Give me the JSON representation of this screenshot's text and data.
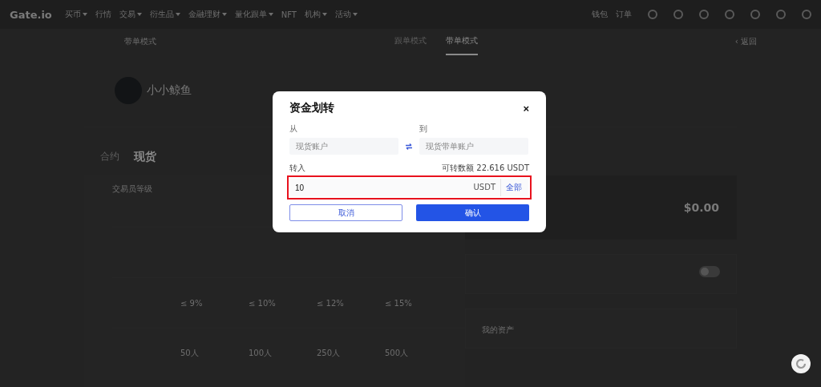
{
  "nav": {
    "logo": "Gate.io",
    "items": [
      {
        "label": "买币",
        "caret": true
      },
      {
        "label": "行情",
        "caret": false
      },
      {
        "label": "交易",
        "caret": true
      },
      {
        "label": "衍生品",
        "caret": true
      },
      {
        "label": "金融理财",
        "caret": true
      },
      {
        "label": "量化跟单",
        "caret": true
      },
      {
        "label": "NFT",
        "caret": false
      },
      {
        "label": "机构",
        "caret": true
      },
      {
        "label": "活动",
        "caret": true
      }
    ],
    "right_items": [
      {
        "label": "钱包"
      },
      {
        "label": "订单"
      }
    ]
  },
  "subbar": {
    "title": "带单模式",
    "tabs": [
      {
        "label": "跟单模式",
        "selected": false
      },
      {
        "label": "带单模式",
        "selected": true
      }
    ],
    "back_icon": "‹",
    "back": "返回"
  },
  "profile": {
    "name": "小小鲸鱼"
  },
  "market_tabs": [
    {
      "label": "合约",
      "selected": false
    },
    {
      "label": "现货",
      "selected": true
    }
  ],
  "level_card": {
    "title": "交易员等级",
    "rows": [
      [
        "≤ 9%",
        "≤ 10%",
        "≤ 12%",
        "≤ 15%"
      ],
      [
        "50人",
        "100人",
        "250人",
        "500人"
      ]
    ]
  },
  "balance": {
    "amount": "$0.00"
  },
  "setting": {
    "on": false
  },
  "assets": {
    "title": "我的资产"
  },
  "dialog": {
    "title": "资金划转",
    "close": "×",
    "from_label": "从",
    "from_value": "现货账户",
    "to_label": "到",
    "to_value": "现货带单账户",
    "amount_label": "转入",
    "available": "可转数额 22.616 USDT",
    "amount": "10",
    "currency": "USDT",
    "all": "全部",
    "cancel": "取消",
    "confirm": "确认"
  }
}
